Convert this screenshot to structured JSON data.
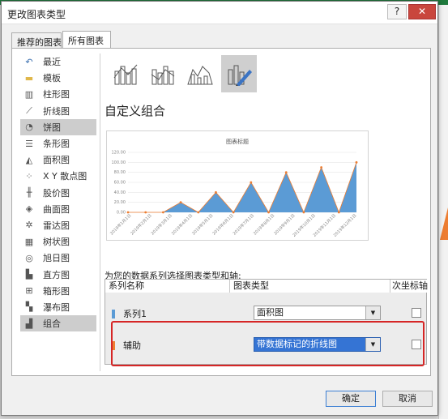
{
  "window": {
    "title": "更改图表类型",
    "help_label": "?",
    "close_label": "✕"
  },
  "tabs": [
    {
      "label": "推荐的图表"
    },
    {
      "label": "所有图表"
    }
  ],
  "sidebar": {
    "items": [
      {
        "label": "最近",
        "icon": "recent-icon"
      },
      {
        "label": "模板",
        "icon": "folder-icon"
      },
      {
        "label": "柱形图",
        "icon": "column-chart-icon"
      },
      {
        "label": "折线图",
        "icon": "line-chart-icon"
      },
      {
        "label": "饼图",
        "icon": "pie-chart-icon",
        "selected": true
      },
      {
        "label": "条形图",
        "icon": "bar-chart-icon"
      },
      {
        "label": "面积图",
        "icon": "area-chart-icon"
      },
      {
        "label": "X Y 散点图",
        "icon": "scatter-chart-icon"
      },
      {
        "label": "股价图",
        "icon": "stock-chart-icon"
      },
      {
        "label": "曲面图",
        "icon": "surface-chart-icon"
      },
      {
        "label": "雷达图",
        "icon": "radar-chart-icon"
      },
      {
        "label": "树状图",
        "icon": "treemap-chart-icon"
      },
      {
        "label": "旭日图",
        "icon": "sunburst-chart-icon"
      },
      {
        "label": "直方图",
        "icon": "histogram-chart-icon"
      },
      {
        "label": "箱形图",
        "icon": "boxplot-chart-icon"
      },
      {
        "label": "瀑布图",
        "icon": "waterfall-chart-icon"
      },
      {
        "label": "组合",
        "icon": "combo-chart-icon",
        "selected": true
      }
    ]
  },
  "main": {
    "heading": "自定义组合",
    "instruction": "为您的数据系列选择图表类型和轴:",
    "table_headers": {
      "name": "系列名称",
      "type": "图表类型",
      "secondary": "次坐标轴"
    },
    "rows": [
      {
        "name": "系列1",
        "type": "面积图",
        "color": "#5b9bd5",
        "secondary": false
      },
      {
        "name": "辅助",
        "type": "带数据标记的折线图",
        "color": "#ed7d31",
        "secondary": false,
        "selected": true
      }
    ]
  },
  "buttons": {
    "ok": "确定",
    "cancel": "取消"
  },
  "chart_data": {
    "type": "area",
    "title": "图表标题",
    "categories": [
      "2019年1月1日",
      "2019年2月1日",
      "2019年3月1日",
      "2019年4月1日",
      "2019年5月1日",
      "2019年6月1日",
      "2019年7月1日",
      "2019年8月1日",
      "2019年9月1日",
      "2019年10月1日",
      "2019年11月1日",
      "2019年12月1日"
    ],
    "x_tick_labels": [
      "2019年1月1日",
      "2019年2月1日",
      "2019年3月1日",
      "2019年4月1日",
      "2019年5月1日",
      "2019年6月1日",
      "2019年7月1日",
      "2019年8月1日",
      "2019年9月1日",
      "2019年10月1日",
      "2019年11月1日",
      "2019年12月1日"
    ],
    "y_tick_labels": [
      "0.00",
      "20.00",
      "40.00",
      "60.00",
      "80.00",
      "100.00",
      "120.00"
    ],
    "ylim": [
      0,
      120
    ],
    "peaks": [
      20,
      40,
      60,
      80,
      90,
      100
    ],
    "series": [
      {
        "name": "系列1",
        "color": "#5b9bd5"
      },
      {
        "name": "辅助",
        "color": "#ed7d31"
      }
    ],
    "grid": true
  }
}
